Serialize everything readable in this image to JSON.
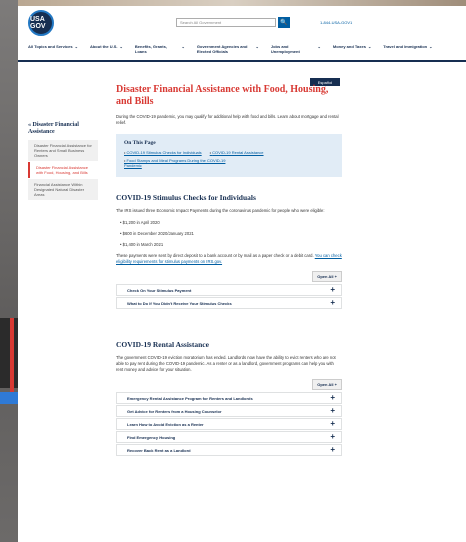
{
  "header": {
    "logo_text": "USA GOV",
    "search_placeholder": "Search All Government",
    "search_button": "🔍",
    "phone": "1-844-USA-GOV1"
  },
  "nav": [
    {
      "label": "All Topics and Services"
    },
    {
      "label": "About the U.S."
    },
    {
      "label": "Benefits, Grants, Loans"
    },
    {
      "label": "Government Agencies and Elected Officials"
    },
    {
      "label": "Jobs and Unemployment"
    },
    {
      "label": "Money and Taxes"
    },
    {
      "label": "Travel and Immigration"
    }
  ],
  "espanol": "Español",
  "sidebar": {
    "heading": "« Disaster Financial Assistance",
    "items": [
      {
        "label": "Disaster Financial Assistance for Renters and Small Business Owners"
      },
      {
        "label": "Disaster Financial Assistance with Food, Housing, and Bills"
      },
      {
        "label": "Financial Assistance Within Designated Natural Disaster Areas"
      }
    ]
  },
  "main": {
    "title": "Disaster Financial Assistance with Food, Housing, and Bills",
    "intro": "During the COVID-19 pandemic, you may qualify for additional help with food and bills. Learn about mortgage and rental relief.",
    "on_this_page": {
      "title": "On This Page",
      "links": [
        "COVID-19 Stimulus Checks for Individuals",
        "COVID-19 Rental Assistance",
        "Food Stamps and Meal Programs During the COVID-19 Pandemic"
      ]
    },
    "stimulus": {
      "heading": "COVID-19 Stimulus Checks for Individuals",
      "para1": "The IRS issued three Economic Impact Payments during the coronavirus pandemic for people who were eligible:",
      "bullets": [
        "$1,200 in April 2020",
        "$600 in December 2020/January 2021",
        "$1,400 in March 2021"
      ],
      "para2": "These payments were sent by direct deposit to a bank account or by mail as a paper check or a debit card.",
      "para2_link": "You can check eligibility requirements for stimulus payments on IRS.gov.",
      "open_all": "Open All +",
      "accordions": [
        "Check On Your Stimulus Payment",
        "What to Do If You Didn't Receive Your Stimulus Checks"
      ]
    },
    "rental": {
      "heading": "COVID-19 Rental Assistance",
      "para": "The government COVID-19 eviction moratorium has ended. Landlords now have the ability to evict renters who are not able to pay rent during the COVID-19 pandemic. As a renter or as a landlord, government programs can help you with rent money and advice for your situation.",
      "open_all": "Open All +",
      "accordions": [
        "Emergency Rental Assistance Program for Renters and Landlords",
        "Get Advice for Renters from a Housing Counselor",
        "Learn How to Avoid Eviction as a Renter",
        "Find Emergency Housing",
        "Recover Back Rent as a Landlord"
      ]
    }
  }
}
